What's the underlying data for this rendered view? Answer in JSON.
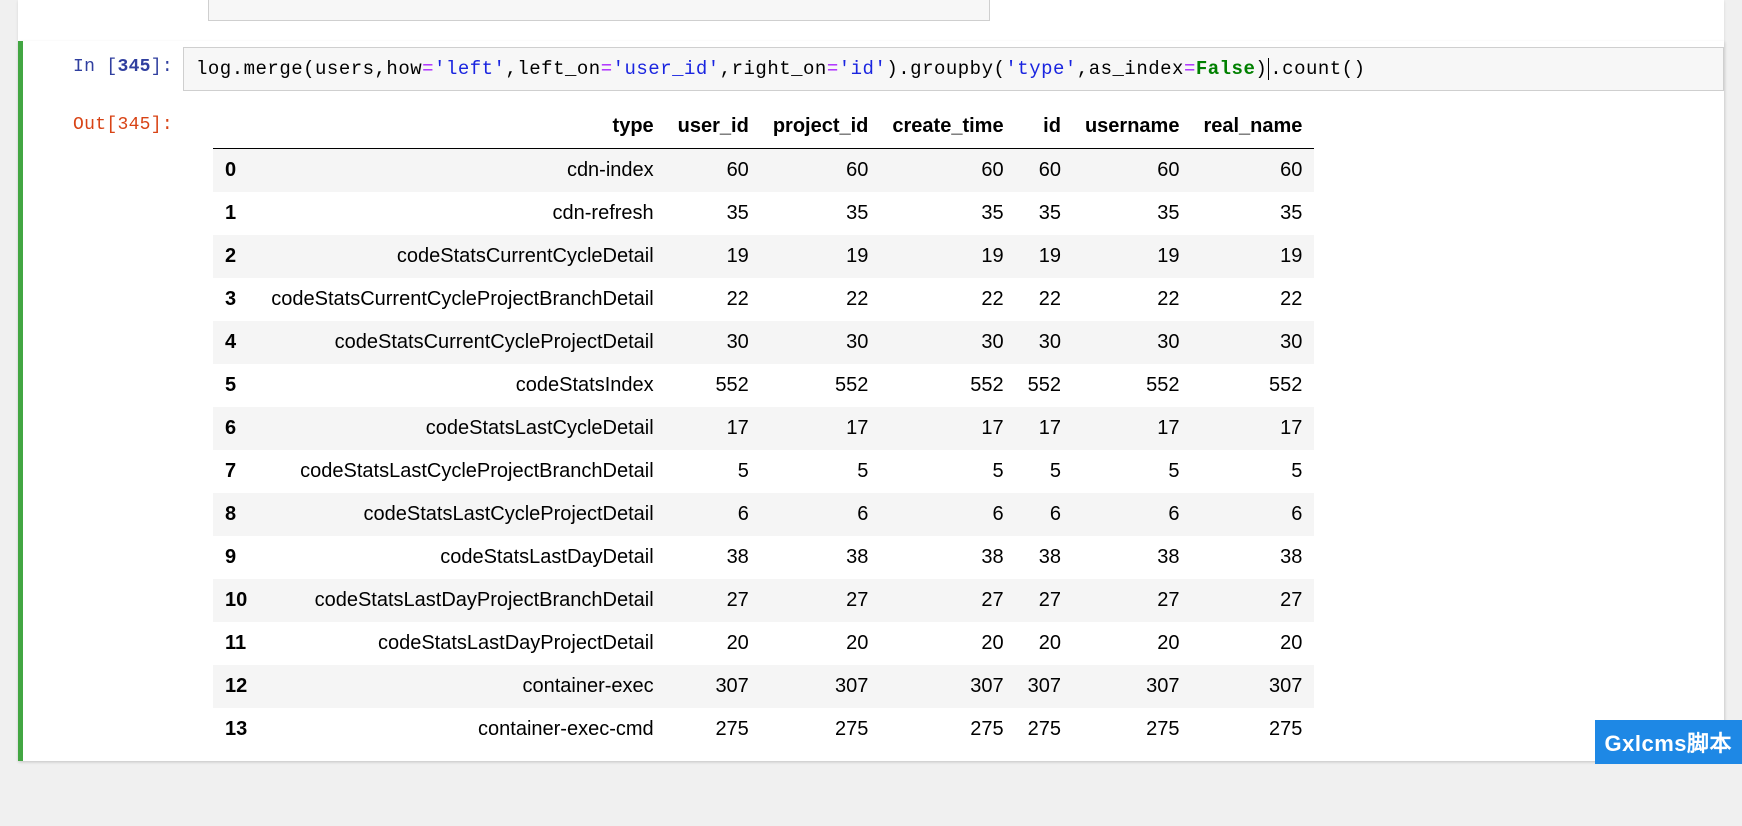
{
  "prompts": {
    "in_prefix": "In [",
    "in_num": "345",
    "in_suffix": "]:",
    "out_prefix": "Out[",
    "out_num": "345",
    "out_suffix": "]:"
  },
  "code": {
    "t1": "log.merge(users,how",
    "eq1": "=",
    "s1": "'left'",
    "t2": ",left_on",
    "eq2": "=",
    "s2": "'user_id'",
    "t3": ",right_on",
    "eq3": "=",
    "s3": "'id'",
    "t4": ").groupby(",
    "s4": "'type'",
    "t5": ",as_index",
    "eq4": "=",
    "kw1": "False",
    "t6": ")",
    "t7": ".count()"
  },
  "table": {
    "columns": [
      "",
      "type",
      "user_id",
      "project_id",
      "create_time",
      "id",
      "username",
      "real_name"
    ],
    "rows": [
      {
        "idx": "0",
        "type": "cdn-index",
        "user_id": "60",
        "project_id": "60",
        "create_time": "60",
        "id": "60",
        "username": "60",
        "real_name": "60"
      },
      {
        "idx": "1",
        "type": "cdn-refresh",
        "user_id": "35",
        "project_id": "35",
        "create_time": "35",
        "id": "35",
        "username": "35",
        "real_name": "35"
      },
      {
        "idx": "2",
        "type": "codeStatsCurrentCycleDetail",
        "user_id": "19",
        "project_id": "19",
        "create_time": "19",
        "id": "19",
        "username": "19",
        "real_name": "19"
      },
      {
        "idx": "3",
        "type": "codeStatsCurrentCycleProjectBranchDetail",
        "user_id": "22",
        "project_id": "22",
        "create_time": "22",
        "id": "22",
        "username": "22",
        "real_name": "22"
      },
      {
        "idx": "4",
        "type": "codeStatsCurrentCycleProjectDetail",
        "user_id": "30",
        "project_id": "30",
        "create_time": "30",
        "id": "30",
        "username": "30",
        "real_name": "30"
      },
      {
        "idx": "5",
        "type": "codeStatsIndex",
        "user_id": "552",
        "project_id": "552",
        "create_time": "552",
        "id": "552",
        "username": "552",
        "real_name": "552"
      },
      {
        "idx": "6",
        "type": "codeStatsLastCycleDetail",
        "user_id": "17",
        "project_id": "17",
        "create_time": "17",
        "id": "17",
        "username": "17",
        "real_name": "17"
      },
      {
        "idx": "7",
        "type": "codeStatsLastCycleProjectBranchDetail",
        "user_id": "5",
        "project_id": "5",
        "create_time": "5",
        "id": "5",
        "username": "5",
        "real_name": "5"
      },
      {
        "idx": "8",
        "type": "codeStatsLastCycleProjectDetail",
        "user_id": "6",
        "project_id": "6",
        "create_time": "6",
        "id": "6",
        "username": "6",
        "real_name": "6"
      },
      {
        "idx": "9",
        "type": "codeStatsLastDayDetail",
        "user_id": "38",
        "project_id": "38",
        "create_time": "38",
        "id": "38",
        "username": "38",
        "real_name": "38"
      },
      {
        "idx": "10",
        "type": "codeStatsLastDayProjectBranchDetail",
        "user_id": "27",
        "project_id": "27",
        "create_time": "27",
        "id": "27",
        "username": "27",
        "real_name": "27"
      },
      {
        "idx": "11",
        "type": "codeStatsLastDayProjectDetail",
        "user_id": "20",
        "project_id": "20",
        "create_time": "20",
        "id": "20",
        "username": "20",
        "real_name": "20"
      },
      {
        "idx": "12",
        "type": "container-exec",
        "user_id": "307",
        "project_id": "307",
        "create_time": "307",
        "id": "307",
        "username": "307",
        "real_name": "307"
      },
      {
        "idx": "13",
        "type": "container-exec-cmd",
        "user_id": "275",
        "project_id": "275",
        "create_time": "275",
        "id": "275",
        "username": "275",
        "real_name": "275"
      }
    ]
  },
  "watermark": "Gxlcms脚本"
}
